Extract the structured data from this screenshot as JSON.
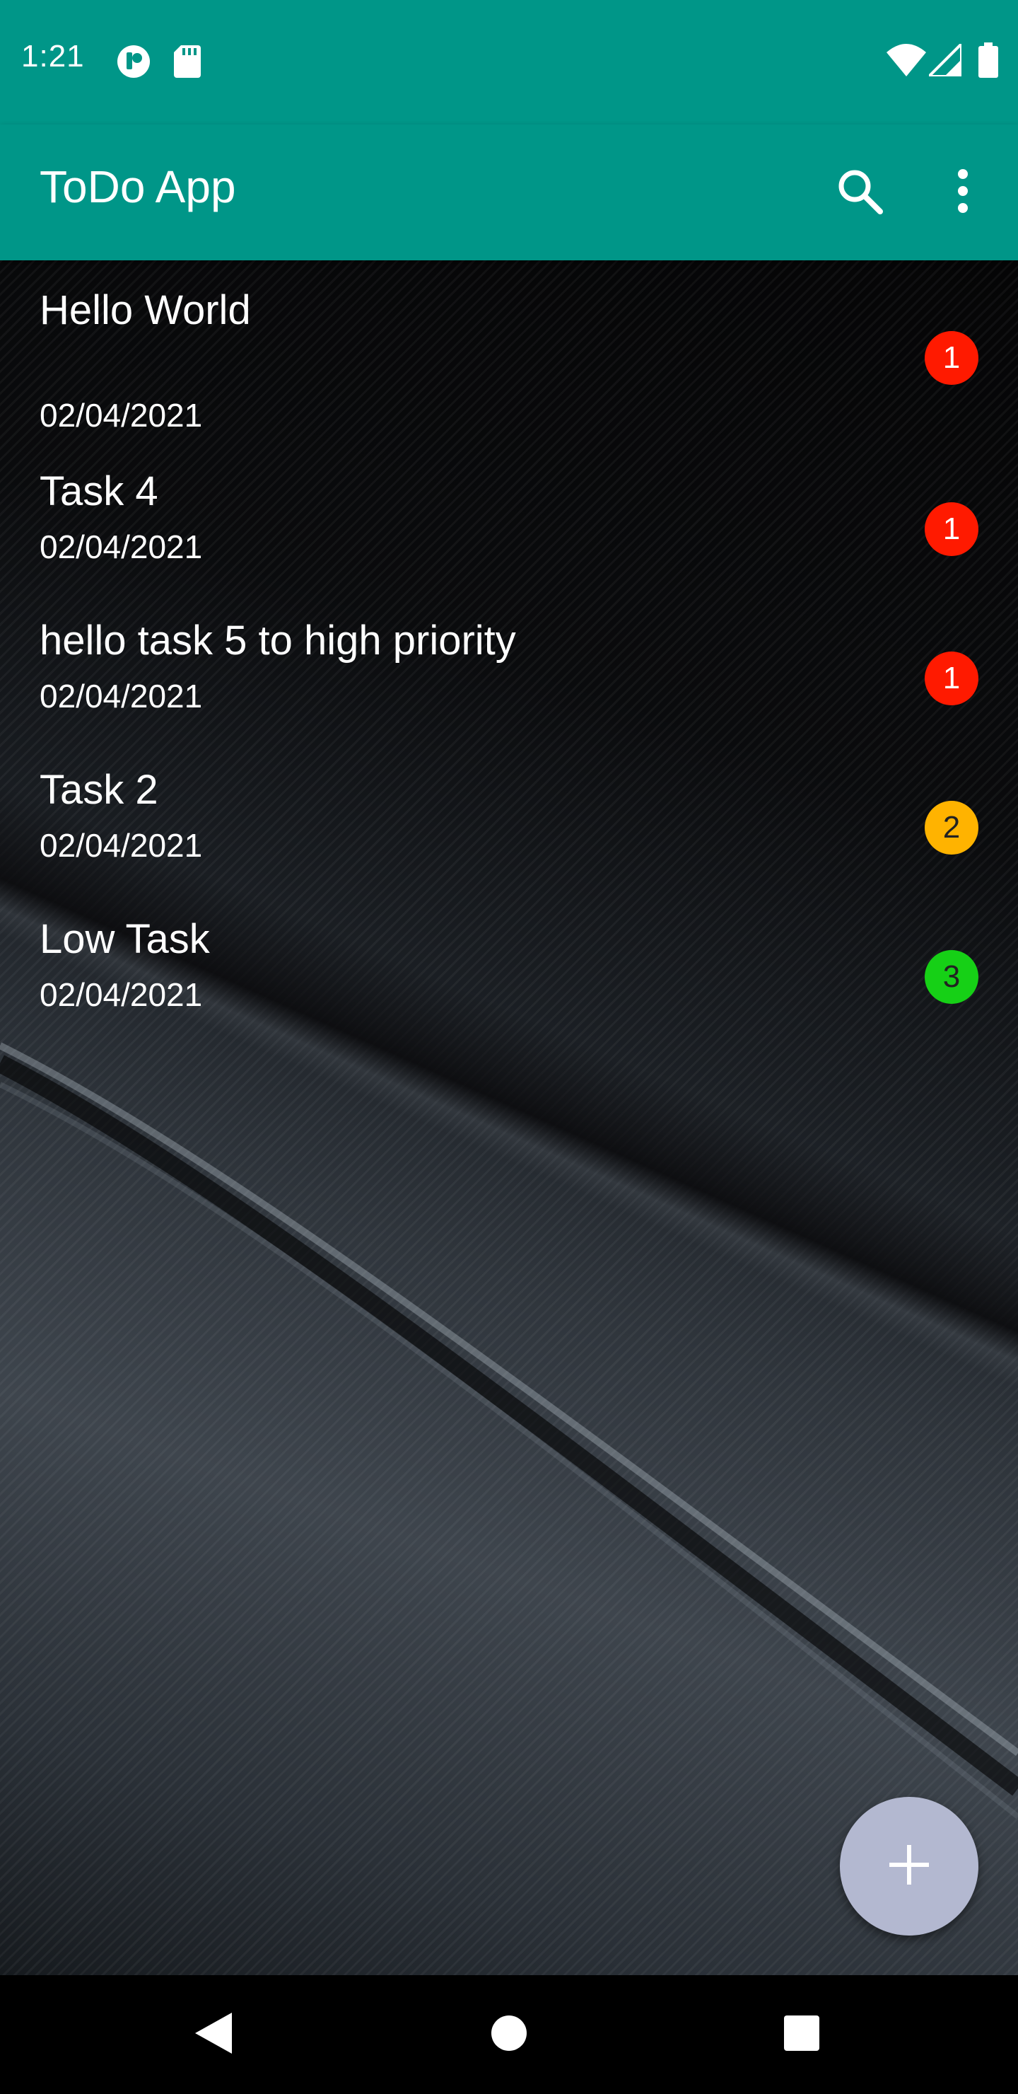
{
  "status_bar": {
    "time": "1:21",
    "icons": [
      "notification-app-icon",
      "sd-card-icon",
      "wifi-icon",
      "signal-icon",
      "battery-icon"
    ]
  },
  "app_bar": {
    "title": "ToDo App",
    "actions": [
      "search-icon",
      "more-vert-icon"
    ]
  },
  "tasks": [
    {
      "title": "Hello World",
      "date": "02/04/2021",
      "priority": "1",
      "priority_color": "#ff1a00"
    },
    {
      "title": "Task 4",
      "date": "02/04/2021",
      "priority": "1",
      "priority_color": "#ff1a00"
    },
    {
      "title": "hello task 5 to high priority",
      "date": "02/04/2021",
      "priority": "1",
      "priority_color": "#ff1a00"
    },
    {
      "title": "Task 2",
      "date": "02/04/2021",
      "priority": "2",
      "priority_color": "#ffb300"
    },
    {
      "title": "Low Task",
      "date": "02/04/2021",
      "priority": "3",
      "priority_color": "#16d016"
    }
  ],
  "fab": {
    "icon": "plus-icon",
    "color": "#b3b8d0"
  },
  "nav_bar": {
    "buttons": [
      "back-icon",
      "home-icon",
      "recents-icon"
    ]
  },
  "colors": {
    "primary": "#009688",
    "on_primary": "#ffffff"
  }
}
